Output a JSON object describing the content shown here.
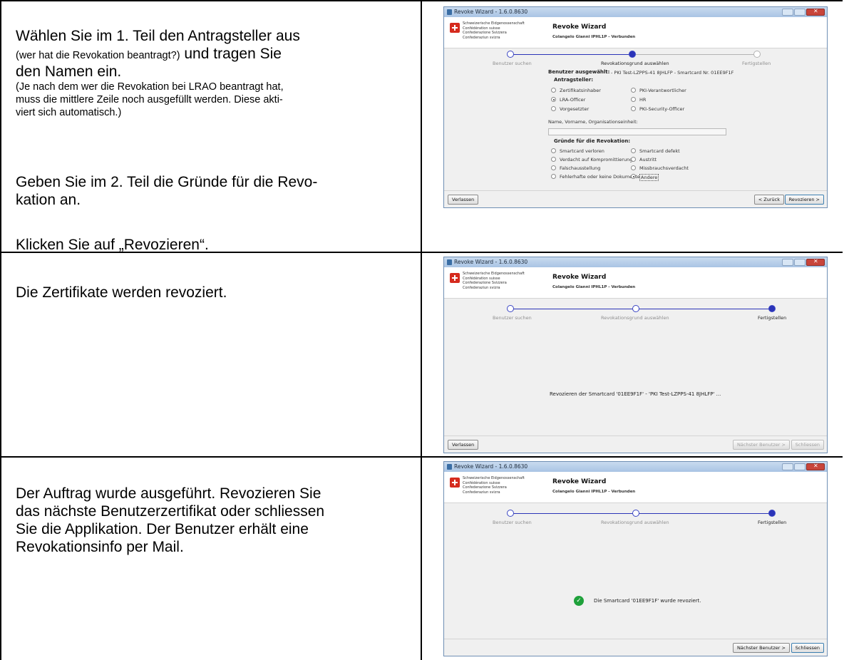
{
  "rows": [
    {
      "instruction": {
        "line1": "Wählen Sie im 1. Teil den Antragsteller aus",
        "line2_small": "(wer hat die Revokation beantragt?)",
        "line2_big": " und tragen Sie",
        "line3": "den Namen ein.",
        "note": "(Je nach dem wer die Revokation bei LRAO beantragt hat, muss die mittlere Zeile noch ausgefüllt werden. Diese akti-viert sich automatisch.)",
        "note_l1": "(Je nach dem wer die Revokation bei LRAO beantragt hat,",
        "note_l2": "muss die mittlere Zeile noch ausgefüllt werden. Diese akti-",
        "note_l3": "viert sich automatisch.)",
        "para2_l1": "Geben Sie im 2. Teil die Gründe für die Revo-",
        "para2_l2": "kation an.",
        "para3": "Klicken Sie auf „Revozieren“."
      },
      "window": {
        "title": "Revoke Wizard - 1.6.0.8630",
        "org_lines": [
          "Schweizerische Eidgenossenschaft",
          "Confédération suisse",
          "Confederazione Svizzera",
          "Confederaziun svizra"
        ],
        "app_title": "Revoke Wizard",
        "subtitle": "Colangelo Gianni IPHL1P - Verbunden",
        "steps": [
          "Benutzer suchen",
          "Revokationsgrund auswählen",
          "Fertigstellen"
        ],
        "selected_user_label": "Benutzer ausgewählt:",
        "selected_user_value": "- PKI Test-LZPPS-41 8JHLFP - Smartcard Nr. 01EE9F1F",
        "applicant_heading": "Antragsteller:",
        "applicants": [
          "Zertifikatsinhaber",
          "PKI-Verantwortlicher",
          "LRA-Officer",
          "HR",
          "Vorgesetzter",
          "PKI-Security-Officer"
        ],
        "name_label": "Name, Vorname, Organisationseinheit:",
        "reasons_heading": "Gründe für die Revokation:",
        "reasons": [
          "Smartcard verloren",
          "Smartcard defekt",
          "Verdacht auf Kompromittierung",
          "Austritt",
          "Falschausstellung",
          "Missbrauchsverdacht",
          "Fehlerhafte oder keine Dokumente",
          "Andere"
        ],
        "btn_leave": "Verlassen",
        "btn_back": "< Zurück",
        "btn_revoke": "Revozieren >"
      }
    },
    {
      "instruction": {
        "text": "Die Zertifikate werden revoziert."
      },
      "window": {
        "title": "Revoke Wizard - 1.6.0.8630",
        "app_title": "Revoke Wizard",
        "subtitle": "Colangelo Gianni IPHL1P - Verbunden",
        "steps": [
          "Benutzer suchen",
          "Revokationsgrund auswählen",
          "Fertigstellen"
        ],
        "message": "Revozieren der Smartcard '01EE9F1F' - 'PKI Test-LZPPS-41 8JHLFP' ...",
        "btn_leave": "Verlassen",
        "btn_next": "Nächster Benutzer >",
        "btn_close": "Schliessen"
      }
    },
    {
      "instruction": {
        "l1": "Der Auftrag wurde ausgeführt. Revozieren Sie",
        "l2": "das nächste Benutzerzertifikat oder schliessen",
        "l3": "Sie die Applikation. Der Benutzer erhält eine",
        "l4": "Revokationsinfo per Mail."
      },
      "window": {
        "title": "Revoke Wizard - 1.6.0.8630",
        "app_title": "Revoke Wizard",
        "subtitle": "Colangelo Gianni IPHL1P - Verbunden",
        "steps": [
          "Benutzer suchen",
          "Revokationsgrund auswählen",
          "Fertigstellen"
        ],
        "message": "Die Smartcard '01EE9F1F' wurde revoziert.",
        "btn_next": "Nächster Benutzer >",
        "btn_close": "Schliessen"
      }
    }
  ],
  "colors": {
    "step_active": "#2b34b8",
    "step_inactive": "#b3b3b3",
    "success": "#1fa13b"
  }
}
